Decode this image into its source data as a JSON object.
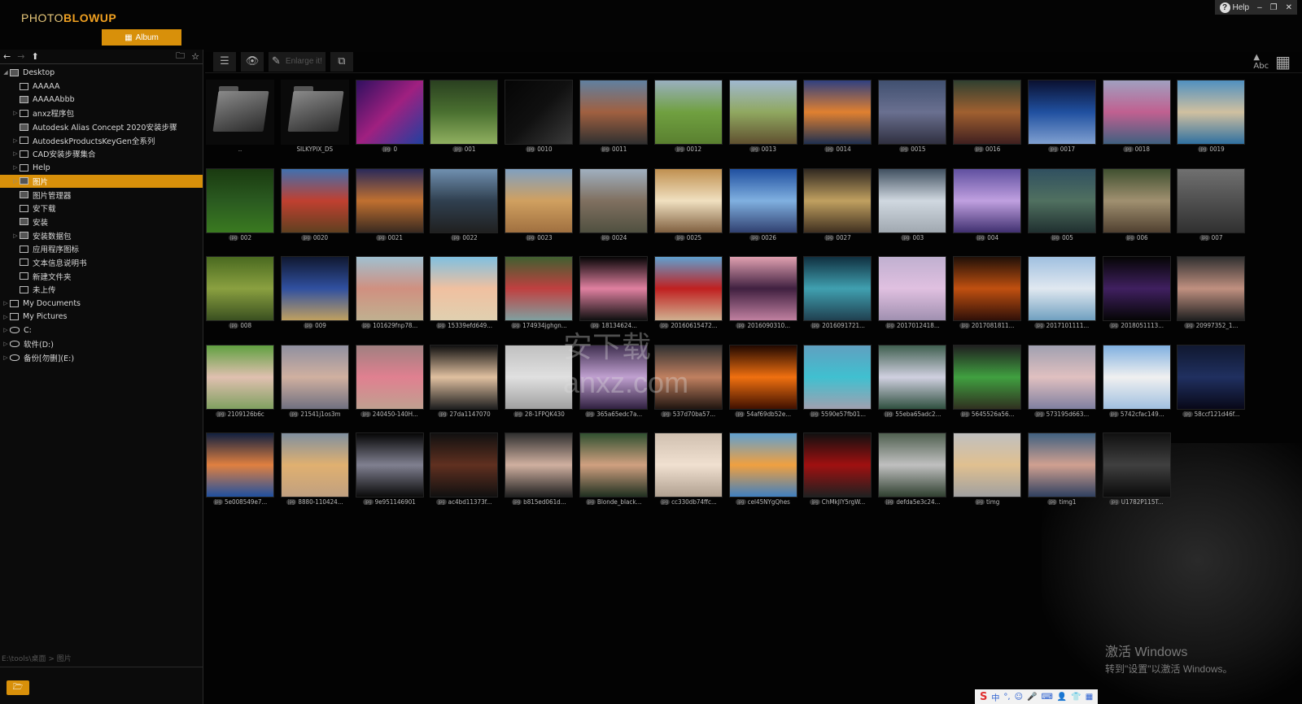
{
  "app": {
    "logo_part1": "PHOTO",
    "logo_part2": "BLOWUP",
    "album_label": "Album"
  },
  "window": {
    "help_label": "Help",
    "minimize": "–",
    "restore": "❐",
    "close": "✕"
  },
  "colors": {
    "accent": "#d8900a",
    "background": "#030303"
  },
  "sidebar": {
    "toolbar": {
      "back": "←",
      "forward": "→",
      "up": "⬆",
      "new_folder": "🗀",
      "favorite": "☆"
    },
    "tree": [
      {
        "label": "Desktop",
        "level": 0,
        "toggle": "◢",
        "icon": "desktop",
        "selected": false
      },
      {
        "label": "AAAAA",
        "level": 1,
        "toggle": "",
        "icon": "folder",
        "selected": false
      },
      {
        "label": "AAAAAbbb",
        "level": 1,
        "toggle": "",
        "icon": "image-folder",
        "selected": false
      },
      {
        "label": "anxz程序包",
        "level": 1,
        "toggle": "▷",
        "icon": "folder",
        "selected": false
      },
      {
        "label": "Autodesk Alias Concept 2020安装步骤",
        "level": 1,
        "toggle": "",
        "icon": "image-folder",
        "selected": false
      },
      {
        "label": "AutodeskProductsKeyGen全系列",
        "level": 1,
        "toggle": "▷",
        "icon": "folder",
        "selected": false
      },
      {
        "label": "CAD安装步骤集合",
        "level": 1,
        "toggle": "▷",
        "icon": "folder",
        "selected": false
      },
      {
        "label": "Help",
        "level": 1,
        "toggle": "▷",
        "icon": "folder",
        "selected": false
      },
      {
        "label": "图片",
        "level": 1,
        "toggle": "▷",
        "icon": "image-folder",
        "selected": true
      },
      {
        "label": "图片管理器",
        "level": 1,
        "toggle": "",
        "icon": "image-folder",
        "selected": false
      },
      {
        "label": "安下载",
        "level": 1,
        "toggle": "",
        "icon": "folder",
        "selected": false
      },
      {
        "label": "安装",
        "level": 1,
        "toggle": "",
        "icon": "image-folder",
        "selected": false
      },
      {
        "label": "安装数据包",
        "level": 1,
        "toggle": "▷",
        "icon": "image-folder",
        "selected": false
      },
      {
        "label": "应用程序图标",
        "level": 1,
        "toggle": "",
        "icon": "folder",
        "selected": false
      },
      {
        "label": "文本信息说明书",
        "level": 1,
        "toggle": "",
        "icon": "folder",
        "selected": false
      },
      {
        "label": "新建文件夹",
        "level": 1,
        "toggle": "",
        "icon": "folder",
        "selected": false
      },
      {
        "label": "未上传",
        "level": 1,
        "toggle": "",
        "icon": "folder",
        "selected": false
      },
      {
        "label": "My Documents",
        "level": 0,
        "toggle": "▷",
        "icon": "folder",
        "selected": false
      },
      {
        "label": "My Pictures",
        "level": 0,
        "toggle": "▷",
        "icon": "folder",
        "selected": false
      },
      {
        "label": "C:",
        "level": 0,
        "toggle": "▷",
        "icon": "drive",
        "selected": false
      },
      {
        "label": "软件(D:)",
        "level": 0,
        "toggle": "▷",
        "icon": "drive",
        "selected": false
      },
      {
        "label": "备份[勿删](E:)",
        "level": 0,
        "toggle": "▷",
        "icon": "drive",
        "selected": false
      }
    ],
    "path": "E:\\tools\\桌面 > 图片"
  },
  "toolbar": {
    "list_view": "☰",
    "preview": "👁",
    "enlarge_label": "Enlarge it!",
    "stack": "⧉",
    "sort_label": "Abc",
    "grid_view": "▦"
  },
  "thumbnails": [
    {
      "name": "..",
      "type": "folder"
    },
    {
      "name": "SILKYPIX_DS",
      "type": "folder"
    },
    {
      "name": "0",
      "bg": "linear-gradient(135deg,#301060,#a02080,#2040a0)"
    },
    {
      "name": "001",
      "bg": "linear-gradient(180deg,#2a4020,#4a7030,#90b060)"
    },
    {
      "name": "0010",
      "bg": "linear-gradient(135deg,#050505,#101010,#3a3a3a)"
    },
    {
      "name": "0011",
      "bg": "linear-gradient(180deg,#6080a0,#a06040,#303030)"
    },
    {
      "name": "0012",
      "bg": "linear-gradient(180deg,#9ab0c0,#70a040,#5a8030)"
    },
    {
      "name": "0013",
      "bg": "linear-gradient(180deg,#a0b8d0,#90a860,#605030)"
    },
    {
      "name": "0014",
      "bg": "linear-gradient(180deg,#304080,#e08030,#203050)"
    },
    {
      "name": "0015",
      "bg": "linear-gradient(180deg,#405070,#6a7090,#303040)"
    },
    {
      "name": "0016",
      "bg": "linear-gradient(180deg,#304030,#a06030,#402020)"
    },
    {
      "name": "0017",
      "bg": "linear-gradient(180deg,#0a1030,#2050a0,#80a0d0)"
    },
    {
      "name": "0018",
      "bg": "linear-gradient(180deg,#a0a0c0,#c06090,#406080)"
    },
    {
      "name": "0019",
      "bg": "linear-gradient(180deg,#5090c0,#d0c0a0,#3070a0)"
    },
    {
      "name": "002",
      "bg": "linear-gradient(180deg,#1a3a10,#2a5a20,#3a7a20)"
    },
    {
      "name": "0020",
      "bg": "linear-gradient(180deg,#4070b0,#c04030,#604020)"
    },
    {
      "name": "0021",
      "bg": "linear-gradient(180deg,#2a2a5a,#c07030,#3a2a20)"
    },
    {
      "name": "0022",
      "bg": "linear-gradient(180deg,#7090b0,#304050,#202020)"
    },
    {
      "name": "0023",
      "bg": "linear-gradient(180deg,#80a0c0,#d0a060,#a07040)"
    },
    {
      "name": "0024",
      "bg": "linear-gradient(180deg,#a0b0c0,#807060,#505040)"
    },
    {
      "name": "0025",
      "bg": "linear-gradient(180deg,#c09050,#f0e0c0,#806040)"
    },
    {
      "name": "0026",
      "bg": "linear-gradient(180deg,#2050a0,#80b0e0,#304070)"
    },
    {
      "name": "0027",
      "bg": "linear-gradient(180deg,#302820,#c0a060,#403020)"
    },
    {
      "name": "003",
      "bg": "linear-gradient(180deg,#405060,#d0d8e0,#a0a8b0)"
    },
    {
      "name": "004",
      "bg": "linear-gradient(180deg,#6050a0,#c0a0e0,#403070)"
    },
    {
      "name": "005",
      "bg": "linear-gradient(180deg,#305060,#507060,#203030)"
    },
    {
      "name": "006",
      "bg": "linear-gradient(180deg,#405030,#a09070,#504030)"
    },
    {
      "name": "007",
      "bg": "linear-gradient(180deg,#707070,#505050,#303030)"
    },
    {
      "name": "008",
      "bg": "linear-gradient(180deg,#4a6a20,#8aa040,#3a5020)"
    },
    {
      "name": "009",
      "bg": "linear-gradient(180deg,#101830,#3050a0,#c0a060)"
    },
    {
      "name": "101629fnp78...",
      "bg": "linear-gradient(180deg,#a0c0d0,#d09080,#c0b090)"
    },
    {
      "name": "15339efd649...",
      "bg": "linear-gradient(180deg,#80c0e0,#f0c0a0,#e0d0b0)"
    },
    {
      "name": "174934jghgn...",
      "bg": "linear-gradient(180deg,#406030,#c04040,#80a0a0)"
    },
    {
      "name": "18134624...",
      "bg": "linear-gradient(180deg,#050505,#e080a0,#101010)"
    },
    {
      "name": "20160615472...",
      "bg": "linear-gradient(180deg,#60a0d0,#c02020,#d0b090)"
    },
    {
      "name": "2016090310...",
      "bg": "linear-gradient(180deg,#e0a0b0,#402040,#c080a0)"
    },
    {
      "name": "2016091721...",
      "bg": "linear-gradient(180deg,#103040,#40a0b0,#204050)"
    },
    {
      "name": "2017012418...",
      "bg": "linear-gradient(180deg,#c0b0d0,#e0c0e0,#a090b0)"
    },
    {
      "name": "2017081811...",
      "bg": "linear-gradient(180deg,#201008,#c05010,#301008)"
    },
    {
      "name": "2017101111...",
      "bg": "linear-gradient(180deg,#a0c0e0,#e0e8f0,#70a0c0)"
    },
    {
      "name": "2018051113...",
      "bg": "linear-gradient(180deg,#050505,#402060,#050505)"
    },
    {
      "name": "20997352_1...",
      "bg": "linear-gradient(180deg,#303030,#c09080,#202020)"
    },
    {
      "name": "2109126b6c",
      "bg": "linear-gradient(180deg,#60a040,#e0c0b0,#80a060)"
    },
    {
      "name": "21541j1os3m",
      "bg": "linear-gradient(180deg,#9090a0,#d0b0a0,#707080)"
    },
    {
      "name": "240450-140H...",
      "bg": "linear-gradient(180deg,#a08080,#e08090,#c0a090)"
    },
    {
      "name": "27da1147070",
      "bg": "linear-gradient(180deg,#101010,#e0c0a0,#202020)"
    },
    {
      "name": "28-1FPQK430",
      "bg": "linear-gradient(180deg,#c0c0c0,#e0e0e0,#a0a0a0)"
    },
    {
      "name": "365a65edc7a...",
      "bg": "linear-gradient(180deg,#403050,#c0a0d0,#302040)"
    },
    {
      "name": "537d70ba57...",
      "bg": "linear-gradient(180deg,#303030,#c08060,#201510)"
    },
    {
      "name": "54af69db52e...",
      "bg": "linear-gradient(180deg,#200800,#f07010,#401000)"
    },
    {
      "name": "5590e57fb01...",
      "bg": "linear-gradient(180deg,#60a0c0,#40c0d0,#a0a0b0)"
    },
    {
      "name": "55eba65adc2...",
      "bg": "linear-gradient(180deg,#406050,#d0d0e0,#305040)"
    },
    {
      "name": "5645526a56...",
      "bg": "linear-gradient(180deg,#202020,#40a040,#303020)"
    },
    {
      "name": "573195d663...",
      "bg": "linear-gradient(180deg,#a0a0b0,#e0c0c0,#8080a0)"
    },
    {
      "name": "5742cfac149...",
      "bg": "linear-gradient(180deg,#80b0e0,#f0f0f0,#a0c0e0)"
    },
    {
      "name": "58ccf121d46f...",
      "bg": "linear-gradient(180deg,#101830,#203060,#080818)"
    },
    {
      "name": "5e008549e7...",
      "bg": "linear-gradient(180deg,#102040,#e08040,#2050a0)"
    },
    {
      "name": "8880-110424...",
      "bg": "linear-gradient(180deg,#8090a0,#e0b070,#c0a080)"
    },
    {
      "name": "9e951146901",
      "bg": "linear-gradient(180deg,#050505,#808090,#0a0a0a)"
    },
    {
      "name": "ac4bd11373f...",
      "bg": "linear-gradient(180deg,#101010,#603020,#101010)"
    },
    {
      "name": "b815ed061d...",
      "bg": "linear-gradient(180deg,#303030,#d0b0a0,#202020)"
    },
    {
      "name": "Blonde_black...",
      "bg": "linear-gradient(180deg,#305030,#d0a080,#203020)"
    },
    {
      "name": "cc330db74ffc...",
      "bg": "linear-gradient(180deg,#d0c0b0,#f0e0d0,#b0a090)"
    },
    {
      "name": "cel45NYgQhes",
      "bg": "linear-gradient(180deg,#60a0d0,#f0a040,#4080c0)"
    },
    {
      "name": "ChMkJlY5rgW...",
      "bg": "linear-gradient(180deg,#101010,#a01010,#202020)"
    },
    {
      "name": "defda5e3c24...",
      "bg": "linear-gradient(180deg,#506050,#c0c0c0,#304030)"
    },
    {
      "name": "timg",
      "bg": "linear-gradient(180deg,#c0c0c0,#e0c090,#a0a0a0)"
    },
    {
      "name": "timg1",
      "bg": "linear-gradient(180deg,#406080,#d0a090,#304060)"
    },
    {
      "name": "U1782P115T...",
      "bg": "linear-gradient(180deg,#101010,#404040,#0a0a0a)"
    }
  ],
  "watermark": {
    "line1": "激活 Windows",
    "line2": "转到\"设置\"以激活 Windows。"
  },
  "ime": {
    "logo": "S",
    "lang": "中",
    "punct": "°,",
    "emoji": "☺",
    "mic": "🎤",
    "keyboard": "⌨",
    "user": "👤",
    "shirt": "👕",
    "apps": "▦"
  },
  "site_watermark": "安下载 anxz.com"
}
